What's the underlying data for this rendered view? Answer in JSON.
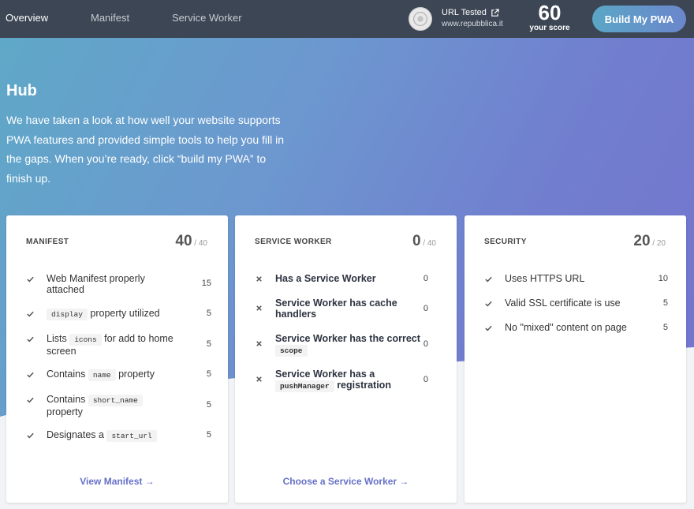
{
  "nav": {
    "tabs": [
      {
        "label": "Overview"
      },
      {
        "label": "Manifest"
      },
      {
        "label": "Service Worker"
      }
    ],
    "url_tested_label": "URL Tested",
    "url_value": "www.repubblica.it",
    "score": "60",
    "score_label": "your score",
    "build_button": "Build My PWA"
  },
  "hero": {
    "title": "Hub",
    "description": "We have taken a look at how well your website supports PWA features and provided simple tools to help you fill in the gaps. When you’re ready, click “build my PWA” to finish up."
  },
  "cards": {
    "manifest": {
      "title": "MANIFEST",
      "score": "40",
      "max": " / 40",
      "link": "View Manifest →",
      "items": [
        {
          "pre": "Web Manifest properly attached",
          "code": "",
          "post": "",
          "points": "15",
          "status": "pass"
        },
        {
          "pre": "",
          "code": "display",
          "post": " property utilized",
          "points": "5",
          "status": "pass"
        },
        {
          "pre": "Lists ",
          "code": "icons",
          "post": " for add to home screen",
          "points": "5",
          "status": "pass"
        },
        {
          "pre": "Contains ",
          "code": "name",
          "post": " property",
          "points": "5",
          "status": "pass"
        },
        {
          "pre": "Contains ",
          "code": "short_name",
          "post": " property",
          "points": "5",
          "status": "pass"
        },
        {
          "pre": "Designates a ",
          "code": "start_url",
          "post": "",
          "points": "5",
          "status": "pass"
        }
      ]
    },
    "service_worker": {
      "title": "SERVICE WORKER",
      "score": "0",
      "max": " / 40",
      "link": "Choose a Service Worker →",
      "items": [
        {
          "pre": "Has a Service Worker",
          "code": "",
          "post": "",
          "points": "0",
          "status": "fail"
        },
        {
          "pre": "Service Worker has cache handlers",
          "code": "",
          "post": "",
          "points": "0",
          "status": "fail"
        },
        {
          "pre": "Service Worker has the correct ",
          "code": "scope",
          "post": "",
          "points": "0",
          "status": "fail"
        },
        {
          "pre": "Service Worker has a ",
          "code": "pushManager",
          "post": " registration",
          "points": "0",
          "status": "fail"
        }
      ]
    },
    "security": {
      "title": "SECURITY",
      "score": "20",
      "max": " / 20",
      "items": [
        {
          "pre": "Uses HTTPS URL",
          "code": "",
          "post": "",
          "points": "10",
          "status": "pass"
        },
        {
          "pre": "Valid SSL certificate is use",
          "code": "",
          "post": "",
          "points": "5",
          "status": "pass"
        },
        {
          "pre": "No \"mixed\" content on page",
          "code": "",
          "post": "",
          "points": "5",
          "status": "pass"
        }
      ]
    }
  },
  "colors": {
    "topbar": "#3c4654",
    "accent_link": "#6670c8",
    "gradient_start": "#5fa8c8",
    "gradient_end": "#7472cd"
  },
  "icons": {
    "pass": "check-icon",
    "fail": "cross-icon",
    "external": "external-link-icon"
  }
}
